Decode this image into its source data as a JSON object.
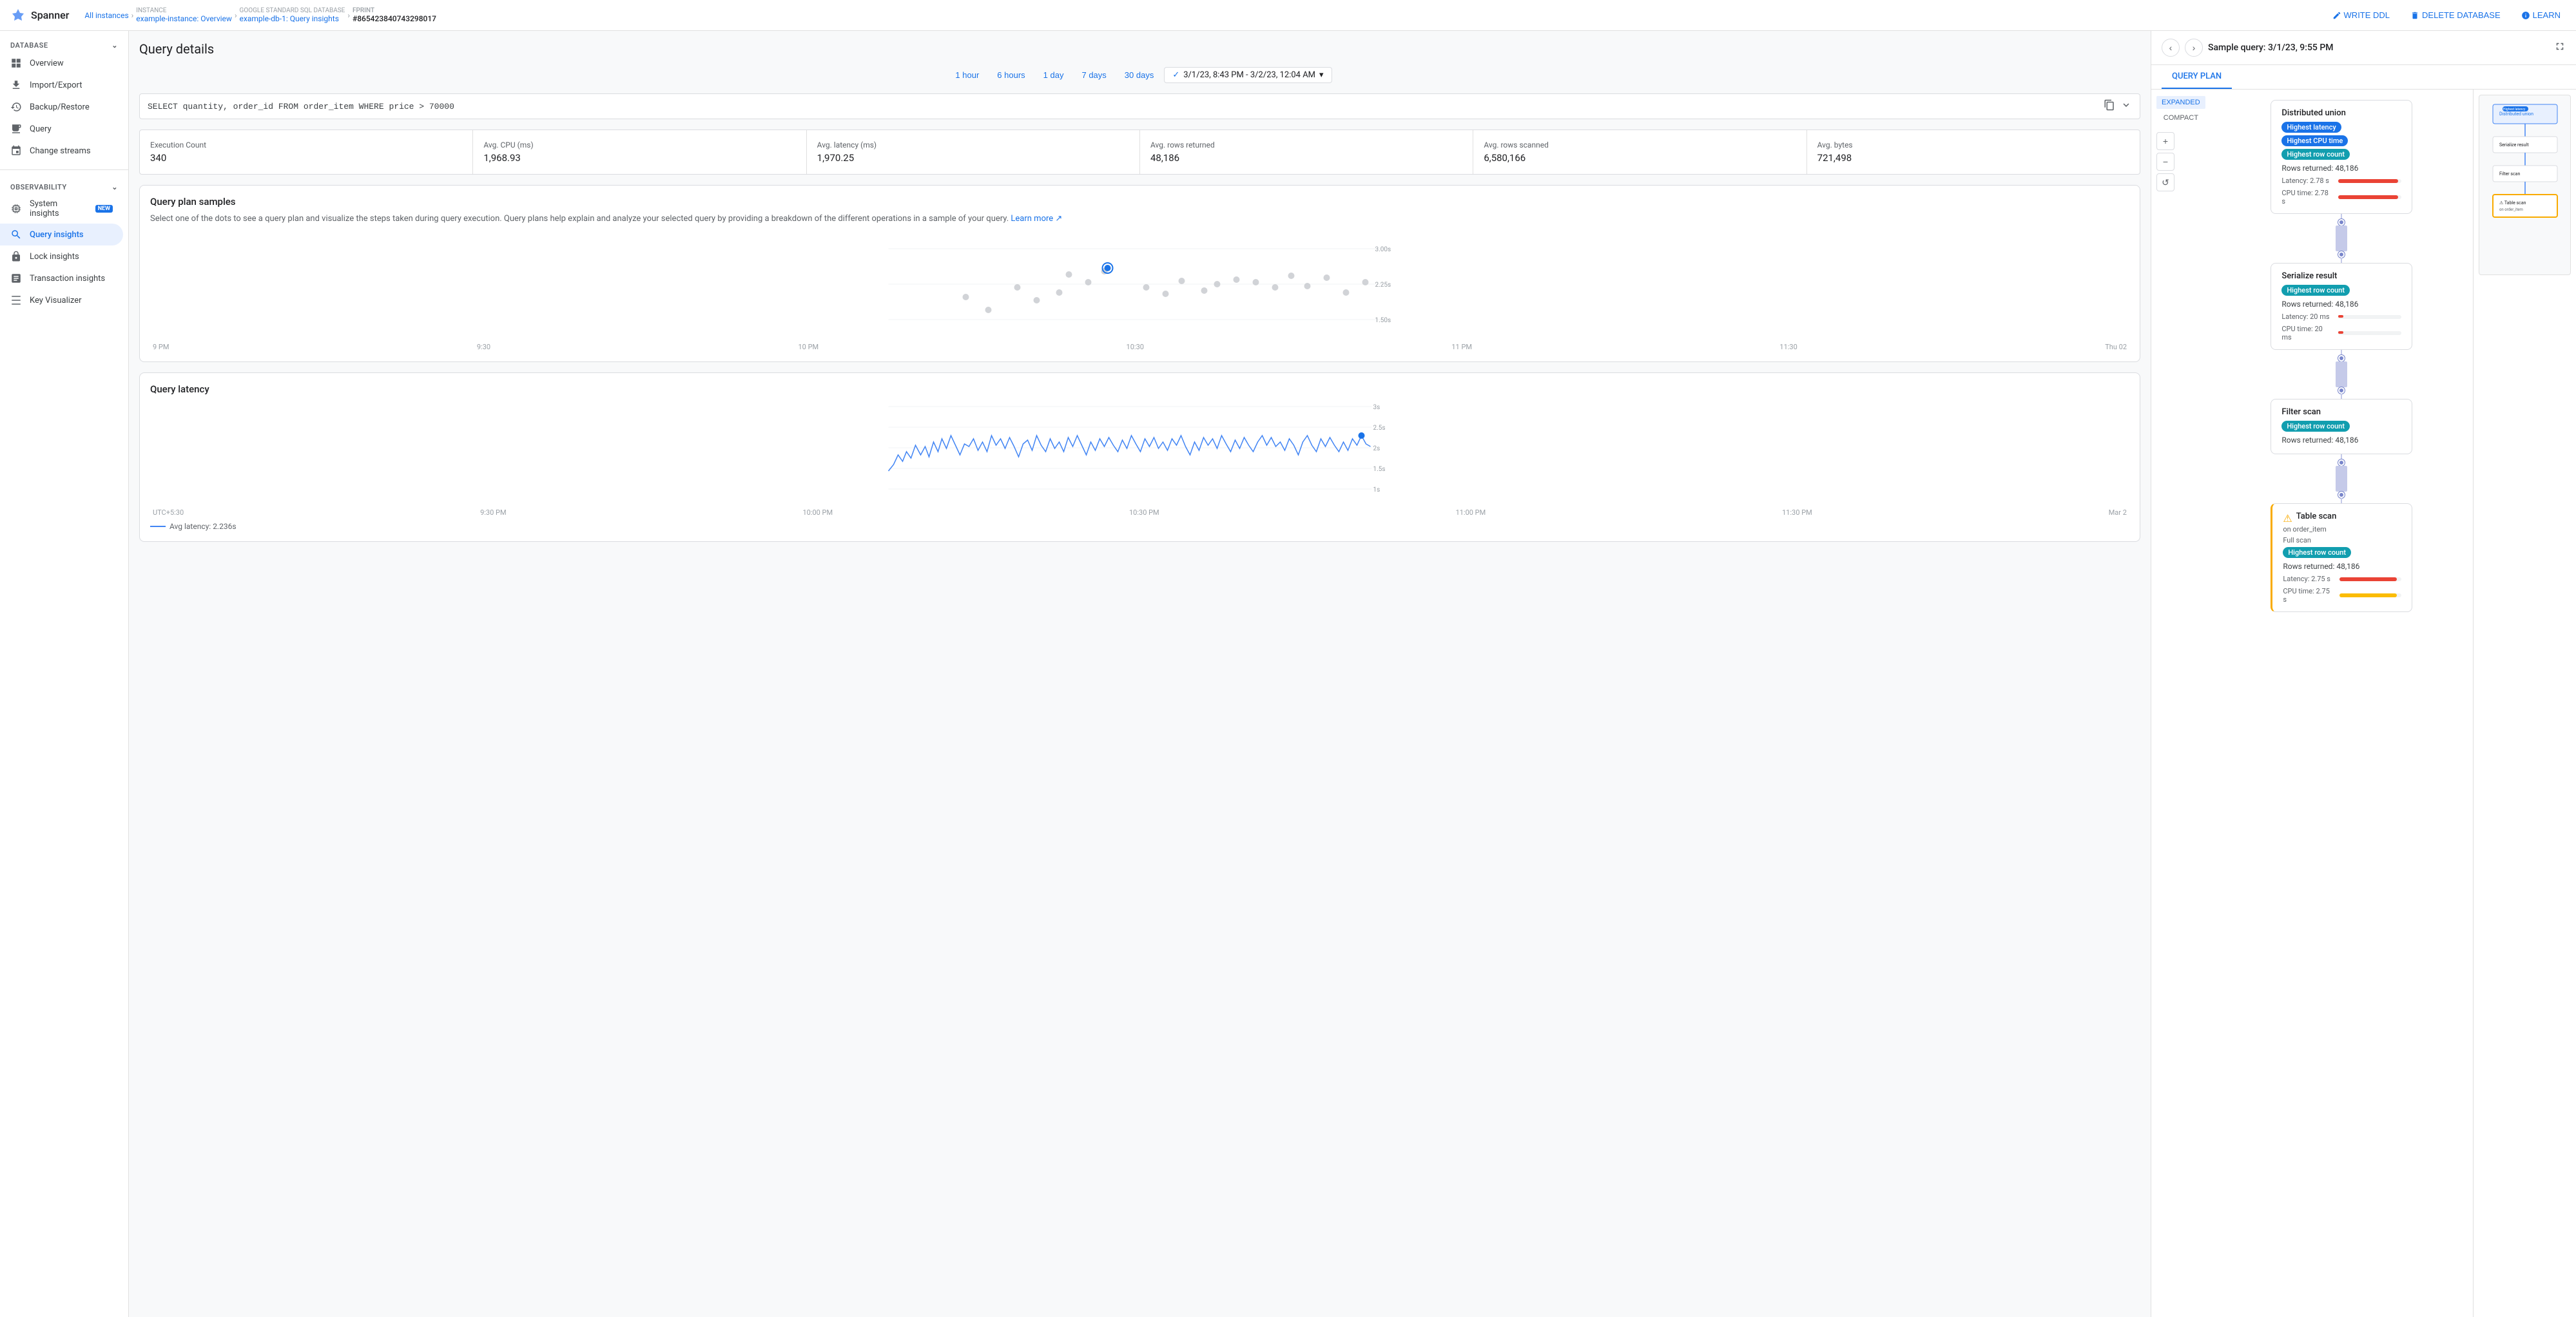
{
  "app": {
    "name": "Spanner"
  },
  "topbar": {
    "breadcrumbs": [
      {
        "label": "All instances",
        "active": false
      },
      {
        "label": "INSTANCE\nexample-instance: Overview",
        "active": false
      },
      {
        "label": "GOOGLE STANDARD SQL DATABASE\nexample-db-1: Query insights",
        "active": false
      },
      {
        "label": "FPRINT\n#865423840743298017",
        "active": true
      }
    ],
    "actions": [
      {
        "label": "WRITE DDL",
        "icon": "edit-icon"
      },
      {
        "label": "DELETE DATABASE",
        "icon": "delete-icon"
      },
      {
        "label": "LEARN",
        "icon": "learn-icon"
      }
    ]
  },
  "sidebar": {
    "database_section": "DATABASE",
    "database_items": [
      {
        "label": "Overview",
        "icon": "overview-icon",
        "active": false
      },
      {
        "label": "Import/Export",
        "icon": "import-icon",
        "active": false
      },
      {
        "label": "Backup/Restore",
        "icon": "backup-icon",
        "active": false
      },
      {
        "label": "Query",
        "icon": "query-icon",
        "active": false
      },
      {
        "label": "Change streams",
        "icon": "streams-icon",
        "active": false
      }
    ],
    "observability_section": "OBSERVABILITY",
    "observability_items": [
      {
        "label": "System insights",
        "icon": "system-icon",
        "badge": "NEW",
        "active": false
      },
      {
        "label": "Query insights",
        "icon": "insights-icon",
        "active": true
      },
      {
        "label": "Lock insights",
        "icon": "lock-icon",
        "active": false
      },
      {
        "label": "Transaction insights",
        "icon": "transaction-icon",
        "active": false
      },
      {
        "label": "Key Visualizer",
        "icon": "key-icon",
        "active": false
      }
    ]
  },
  "page": {
    "title": "Query details",
    "time_filters": [
      "1 hour",
      "6 hours",
      "1 day",
      "7 days",
      "30 days"
    ],
    "time_range": "3/1/23, 8:43 PM - 3/2/23, 12:04 AM",
    "query": "SELECT quantity, order_id FROM order_item WHERE price > 70000",
    "stats": [
      {
        "label": "Execution Count",
        "value": "340"
      },
      {
        "label": "Avg. CPU (ms)",
        "value": "1,968.93"
      },
      {
        "label": "Avg. latency (ms)",
        "value": "1,970.25"
      },
      {
        "label": "Avg. rows returned",
        "value": "48,186"
      },
      {
        "label": "Avg. rows scanned",
        "value": "6,580,166"
      },
      {
        "label": "Avg. bytes",
        "value": "721,498"
      }
    ],
    "query_plan_section": {
      "title": "Query plan samples",
      "description": "Select one of the dots to see a query plan and visualize the steps taken during query execution. Query plans help explain and analyze your selected query by providing a breakdown of the different operations in a sample of your query.",
      "learn_more": "Learn more",
      "chart": {
        "x_labels": [
          "9 PM",
          "9:30",
          "10 PM",
          "10:30",
          "11 PM",
          "11:30",
          "Thu 02"
        ],
        "y_labels": [
          "3.00s",
          "2.25s",
          "1.50s"
        ]
      }
    },
    "latency_section": {
      "title": "Query latency",
      "chart": {
        "x_labels": [
          "UTC+5:30",
          "9:30 PM",
          "10:00 PM",
          "10:30 PM",
          "11:00 PM",
          "11:30 PM",
          "Mar 2"
        ],
        "y_labels": [
          "3s",
          "2.5s",
          "2s",
          "1.5s",
          "1s"
        ]
      },
      "legend": "Avg latency: 2.236s"
    }
  },
  "right_panel": {
    "title": "Sample query: 3/1/23, 9:55 PM",
    "tabs": [
      "QUERY PLAN"
    ],
    "active_tab": "QUERY PLAN",
    "view_modes": [
      "EXPANDED",
      "COMPACT"
    ],
    "active_view": "EXPANDED",
    "nodes": [
      {
        "id": "distributed-union",
        "title": "Distributed union",
        "badges": [
          {
            "label": "Highest latency",
            "color": "blue"
          },
          {
            "label": "Highest CPU time",
            "color": "blue"
          },
          {
            "label": "Highest row count",
            "color": "teal"
          }
        ],
        "rows_returned": "Rows returned: 48,186",
        "latency": "Latency: 2.78 s",
        "cpu_time": "CPU time: 2.78 s",
        "bar_latency_pct": 95,
        "bar_cpu_pct": 95,
        "bar_color": "red",
        "warning": false
      },
      {
        "id": "serialize-result",
        "title": "Serialize result",
        "badges": [
          {
            "label": "Highest row count",
            "color": "teal"
          }
        ],
        "rows_returned": "Rows returned: 48,186",
        "latency": "Latency: 20 ms",
        "cpu_time": "CPU time: 20 ms",
        "bar_latency_pct": 8,
        "bar_cpu_pct": 8,
        "bar_color": "red",
        "warning": false
      },
      {
        "id": "filter-scan",
        "title": "Filter scan",
        "badges": [
          {
            "label": "Highest row count",
            "color": "teal"
          }
        ],
        "rows_returned": "Rows returned: 48,186",
        "latency": "",
        "cpu_time": "",
        "bar_latency_pct": 0,
        "bar_cpu_pct": 0,
        "bar_color": "red",
        "warning": false
      },
      {
        "id": "table-scan",
        "title": "Table scan",
        "sub": "on order_item",
        "sub2": "Full scan",
        "badges": [
          {
            "label": "Highest row count",
            "color": "teal"
          }
        ],
        "rows_returned": "Rows returned: 48,186",
        "latency": "Latency: 2.75 s",
        "cpu_time": "CPU time: 2.75 s",
        "bar_latency_pct": 92,
        "bar_cpu_pct": 92,
        "bar_color": "red",
        "warning": true
      }
    ]
  }
}
